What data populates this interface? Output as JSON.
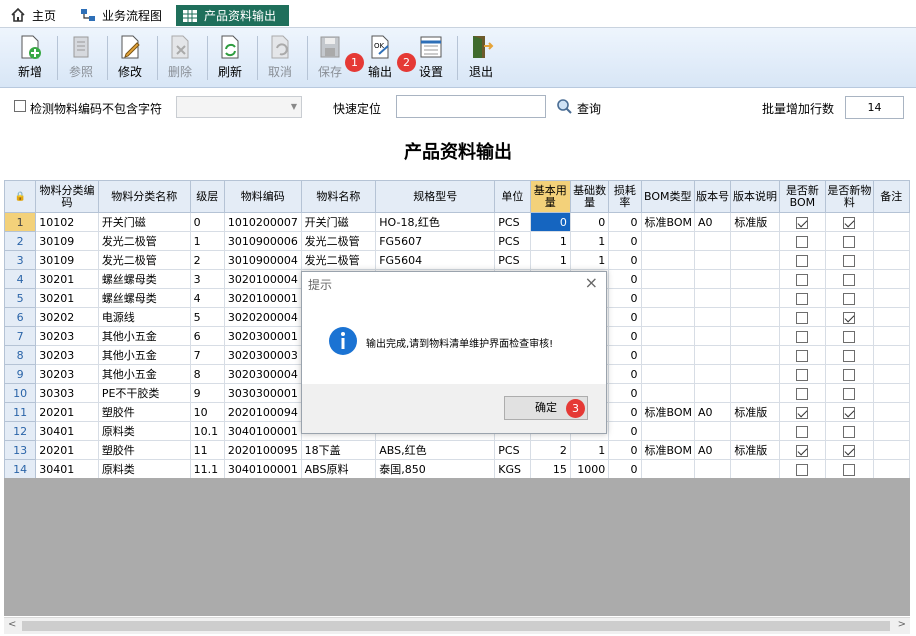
{
  "tabs": [
    {
      "label": "主页"
    },
    {
      "label": "业务流程图"
    },
    {
      "label": "产品资料输出"
    }
  ],
  "toolbar": {
    "add": "新增",
    "ref": "参照",
    "edit": "修改",
    "del": "删除",
    "refresh": "刷新",
    "cancel": "取消",
    "save": "保存",
    "output": "输出",
    "settings": "设置",
    "exit": "退出",
    "badge1": "1",
    "badge2": "2"
  },
  "filter": {
    "checkbox_label": "检测物料编码不包含字符",
    "quick_locate": "快速定位",
    "query": "查询",
    "batch_label": "批量增加行数",
    "batch_value": "14"
  },
  "title": "产品资料输出",
  "table": {
    "headers": [
      "物料分类编码",
      "物料分类名称",
      "级层",
      "物料编码",
      "物料名称",
      "规格型号",
      "单位",
      "基本用量",
      "基础数量",
      "损耗率",
      "BOM类型",
      "版本号",
      "版本说明",
      "是否新BOM",
      "是否新物料",
      "备注"
    ],
    "rows": [
      {
        "n": "1",
        "code": "10102",
        "cname": "开关门磁",
        "lvl": "0",
        "mcode": "1010200007",
        "mname": "开关门磁",
        "spec": "HO-18,红色",
        "unit": "PCS",
        "base": "0",
        "qty": "0",
        "loss": "0",
        "bom": "标准BOM",
        "ver": "A0",
        "vdesc": "标准版",
        "newbom": true,
        "newmat": true
      },
      {
        "n": "2",
        "code": "30109",
        "cname": "发光二极管",
        "lvl": "1",
        "mcode": "3010900006",
        "mname": "发光二极管",
        "spec": "FG5607",
        "unit": "PCS",
        "base": "1",
        "qty": "1",
        "loss": "0",
        "bom": "",
        "ver": "",
        "vdesc": "",
        "newbom": false,
        "newmat": false
      },
      {
        "n": "3",
        "code": "30109",
        "cname": "发光二极管",
        "lvl": "2",
        "mcode": "3010900004",
        "mname": "发光二极管",
        "spec": "FG5604",
        "unit": "PCS",
        "base": "1",
        "qty": "1",
        "loss": "0",
        "bom": "",
        "ver": "",
        "vdesc": "",
        "newbom": false,
        "newmat": false
      },
      {
        "n": "4",
        "code": "30201",
        "cname": "螺丝螺母类",
        "lvl": "3",
        "mcode": "3020100004",
        "mname": "",
        "spec": "",
        "unit": "",
        "base": "",
        "qty": "",
        "loss": "0",
        "bom": "",
        "ver": "",
        "vdesc": "",
        "newbom": false,
        "newmat": false
      },
      {
        "n": "5",
        "code": "30201",
        "cname": "螺丝螺母类",
        "lvl": "4",
        "mcode": "3020100001",
        "mname": "",
        "spec": "",
        "unit": "",
        "base": "",
        "qty": "",
        "loss": "0",
        "bom": "",
        "ver": "",
        "vdesc": "",
        "newbom": false,
        "newmat": false
      },
      {
        "n": "6",
        "code": "30202",
        "cname": "电源线",
        "lvl": "5",
        "mcode": "3020200004",
        "mname": "",
        "spec": "",
        "unit": "",
        "base": "",
        "qty": "",
        "loss": "0",
        "bom": "",
        "ver": "",
        "vdesc": "",
        "newbom": false,
        "newmat": true
      },
      {
        "n": "7",
        "code": "30203",
        "cname": "其他小五金",
        "lvl": "6",
        "mcode": "3020300001",
        "mname": "",
        "spec": "",
        "unit": "",
        "base": "",
        "qty": "",
        "loss": "0",
        "bom": "",
        "ver": "",
        "vdesc": "",
        "newbom": false,
        "newmat": false
      },
      {
        "n": "8",
        "code": "30203",
        "cname": "其他小五金",
        "lvl": "7",
        "mcode": "3020300003",
        "mname": "",
        "spec": "",
        "unit": "",
        "base": "",
        "qty": "",
        "loss": "0",
        "bom": "",
        "ver": "",
        "vdesc": "",
        "newbom": false,
        "newmat": false
      },
      {
        "n": "9",
        "code": "30203",
        "cname": "其他小五金",
        "lvl": "8",
        "mcode": "3020300004",
        "mname": "",
        "spec": "",
        "unit": "",
        "base": "",
        "qty": "",
        "loss": "0",
        "bom": "",
        "ver": "",
        "vdesc": "",
        "newbom": false,
        "newmat": false
      },
      {
        "n": "10",
        "code": "30303",
        "cname": "PE不干胶类",
        "lvl": "9",
        "mcode": "3030300001",
        "mname": "",
        "spec": "",
        "unit": "",
        "base": "",
        "qty": "",
        "loss": "0",
        "bom": "",
        "ver": "",
        "vdesc": "",
        "newbom": false,
        "newmat": false
      },
      {
        "n": "11",
        "code": "20201",
        "cname": "塑胶件",
        "lvl": "10",
        "mcode": "2020100094",
        "mname": "",
        "spec": "",
        "unit": "",
        "base": "",
        "qty": "",
        "loss": "0",
        "bom": "标准BOM",
        "ver": "A0",
        "vdesc": "标准版",
        "newbom": true,
        "newmat": true
      },
      {
        "n": "12",
        "code": "30401",
        "cname": "原料类",
        "lvl": "10.1",
        "mcode": "3040100001",
        "mname": "",
        "spec": "",
        "unit": "",
        "base": "",
        "qty": "",
        "loss": "0",
        "bom": "",
        "ver": "",
        "vdesc": "",
        "newbom": false,
        "newmat": false
      },
      {
        "n": "13",
        "code": "20201",
        "cname": "塑胶件",
        "lvl": "11",
        "mcode": "2020100095",
        "mname": "18下盖",
        "spec": "ABS,红色",
        "unit": "PCS",
        "base": "2",
        "qty": "1",
        "loss": "0",
        "bom": "标准BOM",
        "ver": "A0",
        "vdesc": "标准版",
        "newbom": true,
        "newmat": true
      },
      {
        "n": "14",
        "code": "30401",
        "cname": "原料类",
        "lvl": "11.1",
        "mcode": "3040100001",
        "mname": "ABS原料",
        "spec": "泰国,850",
        "unit": "KGS",
        "base": "15",
        "qty": "1000",
        "loss": "0",
        "bom": "",
        "ver": "",
        "vdesc": "",
        "newbom": false,
        "newmat": false
      }
    ]
  },
  "dialog": {
    "title": "提示",
    "message": "输出完成,请到物料清单维护界面检查审核!",
    "ok": "确定",
    "badge3": "3"
  },
  "colors": {
    "accent": "#1f6f5b",
    "selection": "#1565c0",
    "badge": "#e53935"
  }
}
